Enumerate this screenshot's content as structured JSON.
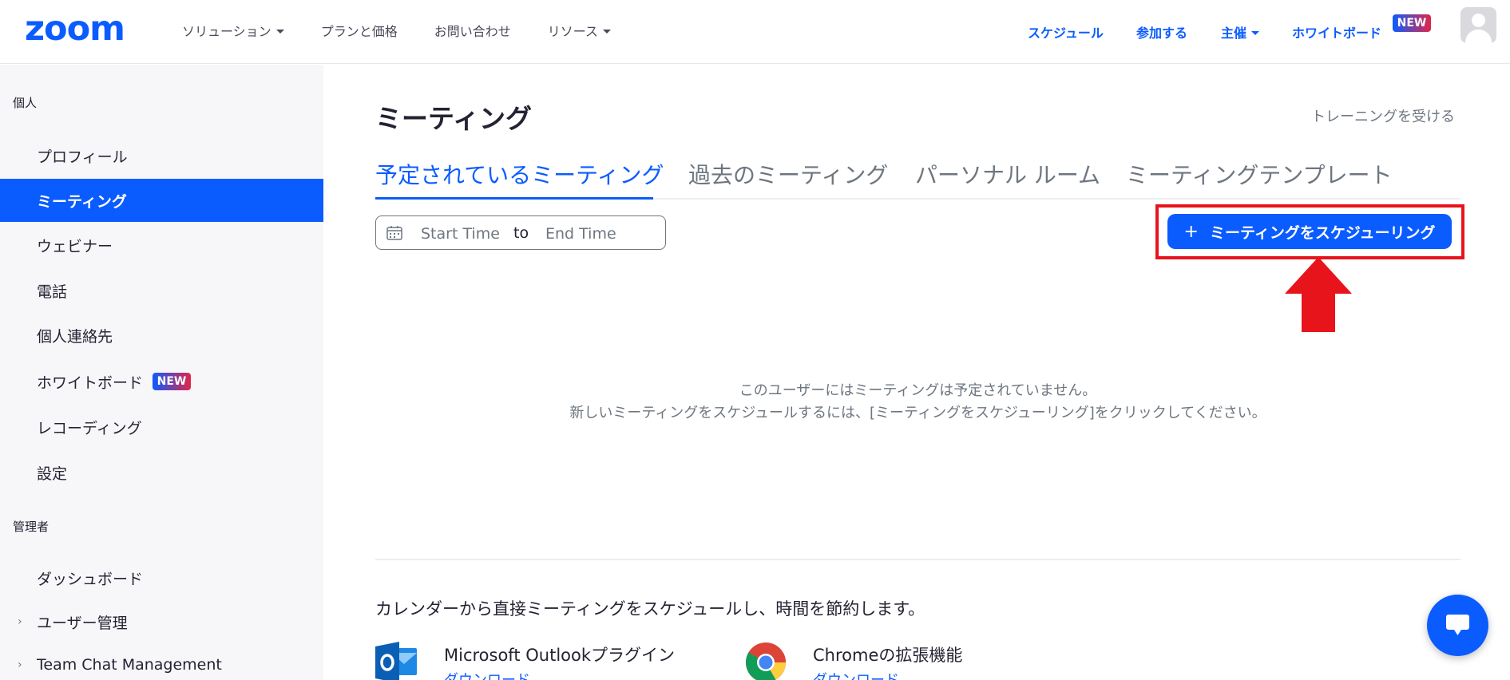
{
  "header": {
    "logo": "zoom",
    "nav_left": [
      {
        "label": "ソリューション",
        "has_caret": true
      },
      {
        "label": "プランと価格",
        "has_caret": false
      },
      {
        "label": "お問い合わせ",
        "has_caret": false
      },
      {
        "label": "リソース",
        "has_caret": true
      }
    ],
    "nav_right": {
      "schedule": "スケジュール",
      "join": "参加する",
      "host": "主催",
      "whiteboard": "ホワイトボード",
      "new_badge": "NEW"
    },
    "avatar_icon": "user-avatar-icon"
  },
  "sidebar": {
    "section_personal": "個人",
    "items": [
      {
        "label": "プロフィール",
        "active": false
      },
      {
        "label": "ミーティング",
        "active": true
      },
      {
        "label": "ウェビナー",
        "active": false
      },
      {
        "label": "電話",
        "active": false
      },
      {
        "label": "個人連絡先",
        "active": false
      },
      {
        "label": "ホワイトボード",
        "active": false,
        "badge": "NEW"
      },
      {
        "label": "レコーディング",
        "active": false
      },
      {
        "label": "設定",
        "active": false
      }
    ],
    "section_admin": "管理者",
    "admin_items": [
      {
        "label": "ダッシュボード"
      },
      {
        "label": "ユーザー管理",
        "expandable": true
      },
      {
        "label": "Team Chat Management",
        "expandable": true
      }
    ]
  },
  "main": {
    "title": "ミーティング",
    "training_link": "トレーニングを受ける",
    "tabs": [
      {
        "label": "予定されているミーティング",
        "active": true
      },
      {
        "label": "過去のミーティング",
        "active": false
      },
      {
        "label": "パーソナル ルーム",
        "active": false
      },
      {
        "label": "ミーティングテンプレート",
        "active": false
      }
    ],
    "date_range": {
      "start_placeholder": "Start Time",
      "separator": "to",
      "end_placeholder": "End Time"
    },
    "schedule_button": {
      "icon": "+",
      "label": "ミーティングをスケジューリング"
    },
    "empty_message": {
      "line1": "このユーザーにはミーティングは予定されていません。",
      "line2": "新しいミーティングをスケジュールするには、[ミーティングをスケジューリング]をクリックしてください。"
    },
    "calendar_promo": "カレンダーから直接ミーティングをスケジュールし、時間を節約します。",
    "plugins": [
      {
        "title": "Microsoft Outlookプラグイン",
        "link": "ダウンロード",
        "icon": "outlook-icon"
      },
      {
        "title": "Chromeの拡張機能",
        "link": "ダウンロード",
        "icon": "chrome-icon"
      }
    ]
  },
  "colors": {
    "accent": "#0b5cff",
    "annotation_red": "#e8141c",
    "sidebar_bg": "#f7f7fa",
    "text_muted": "#6e7680"
  }
}
